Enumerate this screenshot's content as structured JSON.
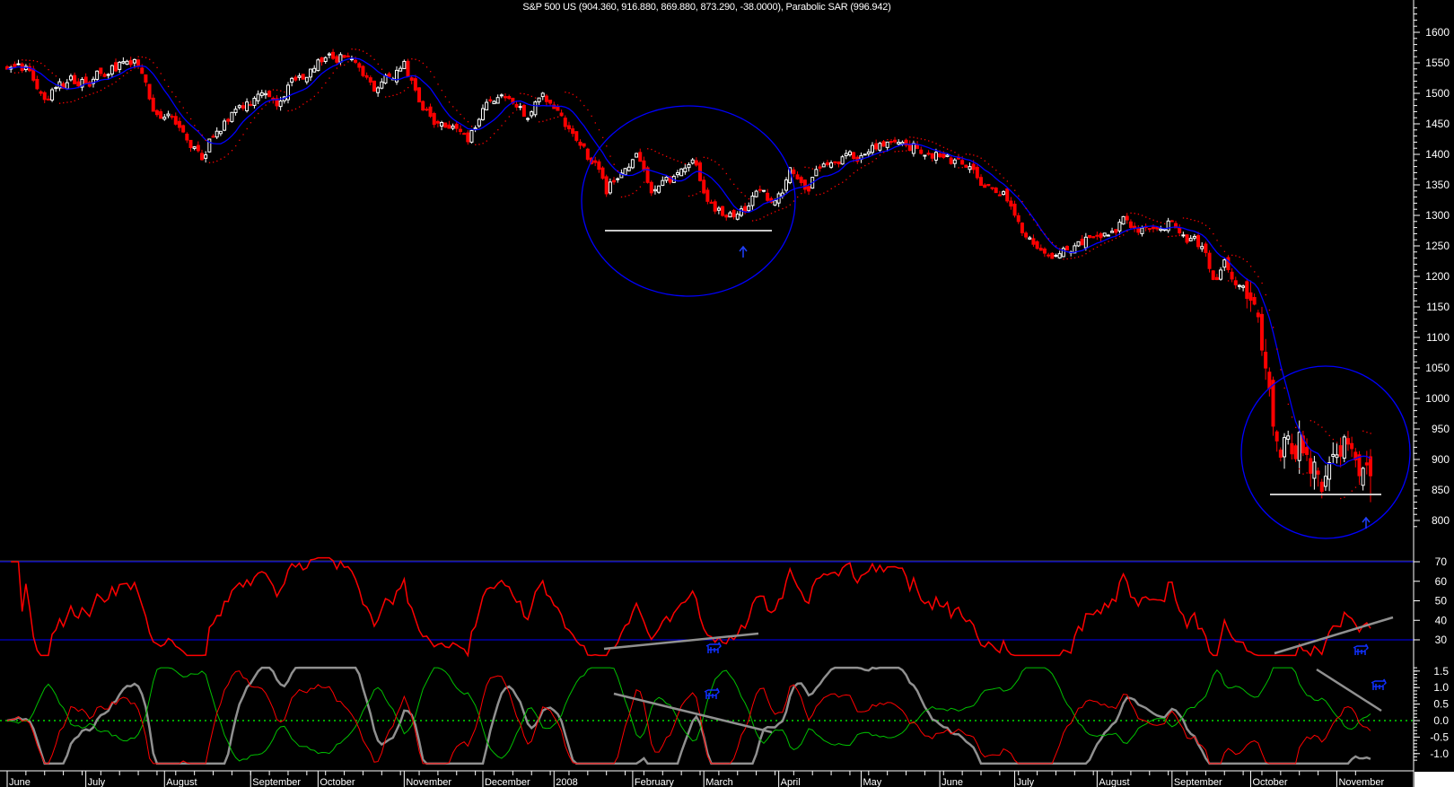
{
  "header": {
    "title": "S&P 500 US (904.360, 916.880, 869.880, 873.290, -38.0000), Parabolic SAR (996.942)"
  },
  "colors": {
    "background": "#000000",
    "up_candle": "#ffffff",
    "down_candle": "#ff0000",
    "moving_average": "#0000ff",
    "sar": "#ff0000",
    "rsi": "#ff0000",
    "annotation": "#0000ff",
    "trendline": "#808080",
    "osc_red": "#ff0000",
    "osc_green": "#00c000",
    "osc_gray": "#909090"
  },
  "chart_data": [
    {
      "type": "candlestick",
      "title": "S&P 500 US (904.360, 916.880, 869.880, 873.290, -38.0000), Parabolic SAR (996.942)",
      "ylim": [
        780,
        1640
      ],
      "y_ticks": [
        "1600",
        "1550",
        "1500",
        "1450",
        "1400",
        "1350",
        "1300",
        "1250",
        "1200",
        "1150",
        "1100",
        "1050",
        "1000",
        "950",
        "900",
        "850",
        "800"
      ],
      "x_unit": "trading day since 2007-06-01",
      "last_bar": {
        "open": 904.36,
        "high": 916.88,
        "low": 869.88,
        "close": 873.29,
        "change": -38.0
      },
      "sar_last": 996.942,
      "close_anchors": [
        [
          0,
          1530
        ],
        [
          5,
          1535
        ],
        [
          10,
          1505
        ],
        [
          18,
          1520
        ],
        [
          22,
          1525
        ],
        [
          28,
          1545
        ],
        [
          34,
          1550
        ],
        [
          38,
          1490
        ],
        [
          41,
          1460
        ],
        [
          46,
          1450
        ],
        [
          52,
          1400
        ],
        [
          56,
          1450
        ],
        [
          61,
          1470
        ],
        [
          66,
          1490
        ],
        [
          72,
          1480
        ],
        [
          77,
          1525
        ],
        [
          83,
          1550
        ],
        [
          91,
          1565
        ],
        [
          96,
          1520
        ],
        [
          98,
          1500
        ],
        [
          102,
          1520
        ],
        [
          106,
          1545
        ],
        [
          110,
          1480
        ],
        [
          114,
          1450
        ],
        [
          119,
          1440
        ],
        [
          123,
          1410
        ],
        [
          127,
          1470
        ],
        [
          132,
          1510
        ],
        [
          136,
          1480
        ],
        [
          139,
          1460
        ],
        [
          143,
          1500
        ],
        [
          148,
          1460
        ],
        [
          153,
          1410
        ],
        [
          157,
          1380
        ],
        [
          160,
          1330
        ],
        [
          164,
          1380
        ],
        [
          168,
          1390
        ],
        [
          172,
          1350
        ],
        [
          176,
          1360
        ],
        [
          183,
          1380
        ],
        [
          186,
          1340
        ],
        [
          192,
          1290
        ],
        [
          196,
          1300
        ],
        [
          200,
          1330
        ],
        [
          205,
          1320
        ],
        [
          209,
          1370
        ],
        [
          214,
          1350
        ],
        [
          217,
          1380
        ],
        [
          222,
          1390
        ],
        [
          227,
          1400
        ],
        [
          232,
          1410
        ],
        [
          237,
          1430
        ],
        [
          241,
          1420
        ],
        [
          246,
          1400
        ],
        [
          251,
          1395
        ],
        [
          256,
          1370
        ],
        [
          261,
          1350
        ],
        [
          266,
          1330
        ],
        [
          269,
          1290
        ],
        [
          273,
          1260
        ],
        [
          279,
          1220
        ],
        [
          283,
          1250
        ],
        [
          289,
          1270
        ],
        [
          295,
          1280
        ],
        [
          299,
          1290
        ],
        [
          305,
          1280
        ],
        [
          310,
          1290
        ],
        [
          315,
          1260
        ],
        [
          319,
          1250
        ],
        [
          322,
          1200
        ],
        [
          325,
          1220
        ],
        [
          330,
          1180
        ],
        [
          334,
          1100
        ],
        [
          336,
          1020
        ],
        [
          340,
          930
        ],
        [
          342,
          960
        ],
        [
          347,
          920
        ],
        [
          351,
          860
        ],
        [
          355,
          940
        ],
        [
          357,
          970
        ],
        [
          360,
          920
        ],
        [
          362,
          890
        ],
        [
          364,
          873
        ]
      ]
    },
    {
      "type": "line",
      "name": "RSI",
      "ylim": [
        20,
        75
      ],
      "y_ticks": [
        "70",
        "60",
        "50",
        "40",
        "30"
      ],
      "reference_lines": [
        70,
        30
      ]
    },
    {
      "type": "line",
      "name": "Oscillator",
      "series": [
        "red",
        "green",
        "gray"
      ],
      "ylim": [
        -1.35,
        1.75
      ],
      "y_ticks": [
        "1.5",
        "1.0",
        "0.5",
        "0.0",
        "-0.5",
        "-1.0"
      ],
      "reference_lines": [
        0
      ]
    }
  ],
  "x_axis": {
    "months": [
      {
        "label": "June",
        "day": 0
      },
      {
        "label": "July",
        "day": 21
      },
      {
        "label": "August",
        "day": 42
      },
      {
        "label": "September",
        "day": 65
      },
      {
        "label": "October",
        "day": 83
      },
      {
        "label": "November",
        "day": 106
      },
      {
        "label": "December",
        "day": 127
      },
      {
        "label": "2008",
        "day": 146
      },
      {
        "label": "February",
        "day": 167
      },
      {
        "label": "March",
        "day": 186
      },
      {
        "label": "April",
        "day": 206
      },
      {
        "label": "May",
        "day": 228
      },
      {
        "label": "June",
        "day": 249
      },
      {
        "label": "July",
        "day": 269
      },
      {
        "label": "August",
        "day": 291
      },
      {
        "label": "September",
        "day": 311
      },
      {
        "label": "October",
        "day": 332
      },
      {
        "label": "November",
        "day": 355
      }
    ]
  }
}
